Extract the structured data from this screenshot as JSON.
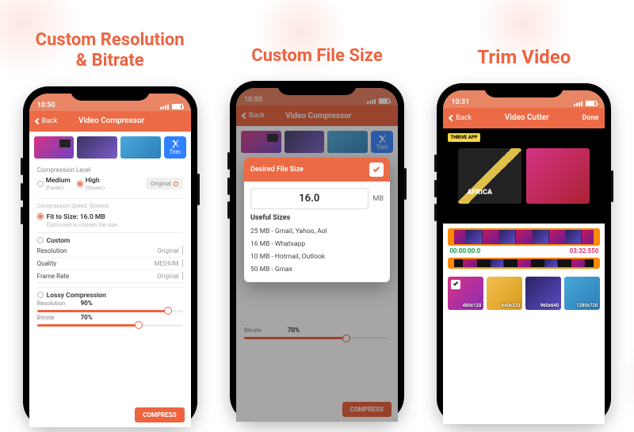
{
  "colors": {
    "accent": "#ec6440",
    "accent2": "#e88564",
    "blue": "#2f80ff",
    "orange": "#ff8a00"
  },
  "headlines": {
    "col1_line1": "Custom Resolution",
    "col1_line2": "& Bitrate",
    "col2": "Custom File Size",
    "col3": "Trim Video"
  },
  "screen1": {
    "status_time": "10:50",
    "back": "Back",
    "title": "Video Compressor",
    "trim_label": "Trim",
    "section_compression_level": "Compression Level",
    "medium": "Medium",
    "medium_sub": "(Faster)",
    "high": "High",
    "high_sub": "(Slower)",
    "original": "Original",
    "speed_line": "Compression Speed: Slowest",
    "fit_label_prefix": "Fit to Size:",
    "fit_size": "16.0 MB",
    "fit_sub": "Optimized to chosen file size",
    "custom": "Custom",
    "rows": {
      "resolution": "Resolution",
      "resolution_v": "Original",
      "quality": "Quality",
      "quality_v": "MEDIUM",
      "framerate": "Frame Rate",
      "framerate_v": "Original"
    },
    "lossy": "Lossy Compression",
    "slider_res_label": "Resolution",
    "slider_res_pct": "90%",
    "slider_bit_label": "Bitrate",
    "slider_bit_pct": "70%",
    "compress": "COMPRESS"
  },
  "screen2": {
    "status_time": "10:50",
    "back": "Back",
    "title": "Video Compressor",
    "modal_title": "Desired File Size",
    "value": "16.0",
    "unit": "MB",
    "useful": "Useful Sizes",
    "list": [
      "25 MB - Gmail, Yahoo, Aol",
      "16 MB - Whatsapp",
      "10 MB - Hotmail, Outlook",
      "50 MB - Gmax"
    ],
    "slider_bit_label": "Bitrate",
    "slider_bit_pct": "70%",
    "compress": "COMPRESS"
  },
  "screen3": {
    "status_time": "10:31",
    "back": "Back",
    "title": "Video Cutter",
    "done": "Done",
    "poster_badge": "THRIVE APP",
    "poster_text": "AFRICA",
    "time_start": "00:00:00:0",
    "time_end": "03:32:550",
    "clips": [
      {
        "res": "480x120",
        "checked": true
      },
      {
        "res": "640x320"
      },
      {
        "res": "960x640"
      },
      {
        "res": "1280x720"
      }
    ]
  }
}
